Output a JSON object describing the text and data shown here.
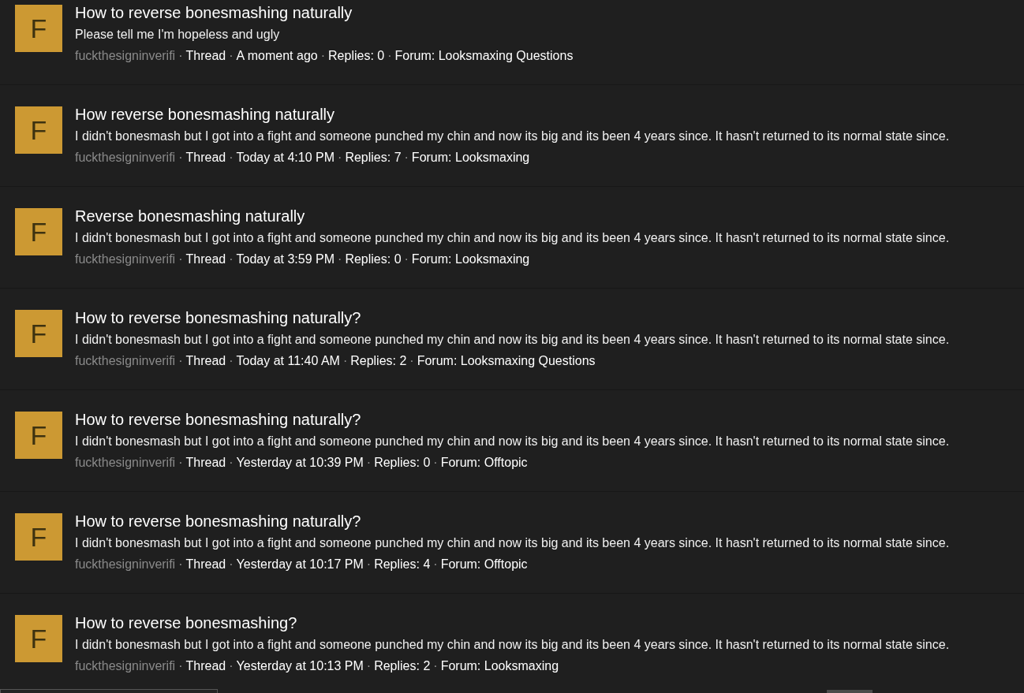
{
  "meta_separator": "·",
  "results": [
    {
      "avatar_letter": "F",
      "title": "How to reverse bonesmashing naturally",
      "snippet": "Please tell me I'm hopeless and ugly",
      "author": "fuckthesigninverifi",
      "type": "Thread",
      "date": "A moment ago",
      "replies": "Replies: 0",
      "forum": "Forum: Looksmaxing Questions"
    },
    {
      "avatar_letter": "F",
      "title": "How reverse bonesmashing naturally",
      "snippet": "I didn't bonesmash but I got into a fight and someone punched my chin and now its big and its been 4 years since. It hasn't returned to its normal state since.",
      "author": "fuckthesigninverifi",
      "type": "Thread",
      "date": "Today at 4:10 PM",
      "replies": "Replies: 7",
      "forum": "Forum: Looksmaxing"
    },
    {
      "avatar_letter": "F",
      "title": "Reverse bonesmashing naturally",
      "snippet": "I didn't bonesmash but I got into a fight and someone punched my chin and now its big and its been 4 years since. It hasn't returned to its normal state since.",
      "author": "fuckthesigninverifi",
      "type": "Thread",
      "date": "Today at 3:59 PM",
      "replies": "Replies: 0",
      "forum": "Forum: Looksmaxing"
    },
    {
      "avatar_letter": "F",
      "title": "How to reverse bonesmashing naturally?",
      "snippet": "I didn't bonesmash but I got into a fight and someone punched my chin and now its big and its been 4 years since. It hasn't returned to its normal state since.",
      "author": "fuckthesigninverifi",
      "type": "Thread",
      "date": "Today at 11:40 AM",
      "replies": "Replies: 2",
      "forum": "Forum: Looksmaxing Questions"
    },
    {
      "avatar_letter": "F",
      "title": "How to reverse bonesmashing naturally?",
      "snippet": "I didn't bonesmash but I got into a fight and someone punched my chin and now its big and its been 4 years since. It hasn't returned to its normal state since.",
      "author": "fuckthesigninverifi",
      "type": "Thread",
      "date": "Yesterday at 10:39 PM",
      "replies": "Replies: 0",
      "forum": "Forum: Offtopic"
    },
    {
      "avatar_letter": "F",
      "title": "How to reverse bonesmashing naturally?",
      "snippet": "I didn't bonesmash but I got into a fight and someone punched my chin and now its big and its been 4 years since. It hasn't returned to its normal state since.",
      "author": "fuckthesigninverifi",
      "type": "Thread",
      "date": "Yesterday at 10:17 PM",
      "replies": "Replies: 4",
      "forum": "Forum: Offtopic"
    },
    {
      "avatar_letter": "F",
      "title": "How to reverse bonesmashing?",
      "snippet": "I didn't bonesmash but I got into a fight and someone punched my chin and now its big and its been 4 years since. It hasn't returned to its normal state since.",
      "author": "fuckthesigninverifi",
      "type": "Thread",
      "date": "Yesterday at 10:13 PM",
      "replies": "Replies: 2",
      "forum": "Forum: Looksmaxing"
    }
  ]
}
